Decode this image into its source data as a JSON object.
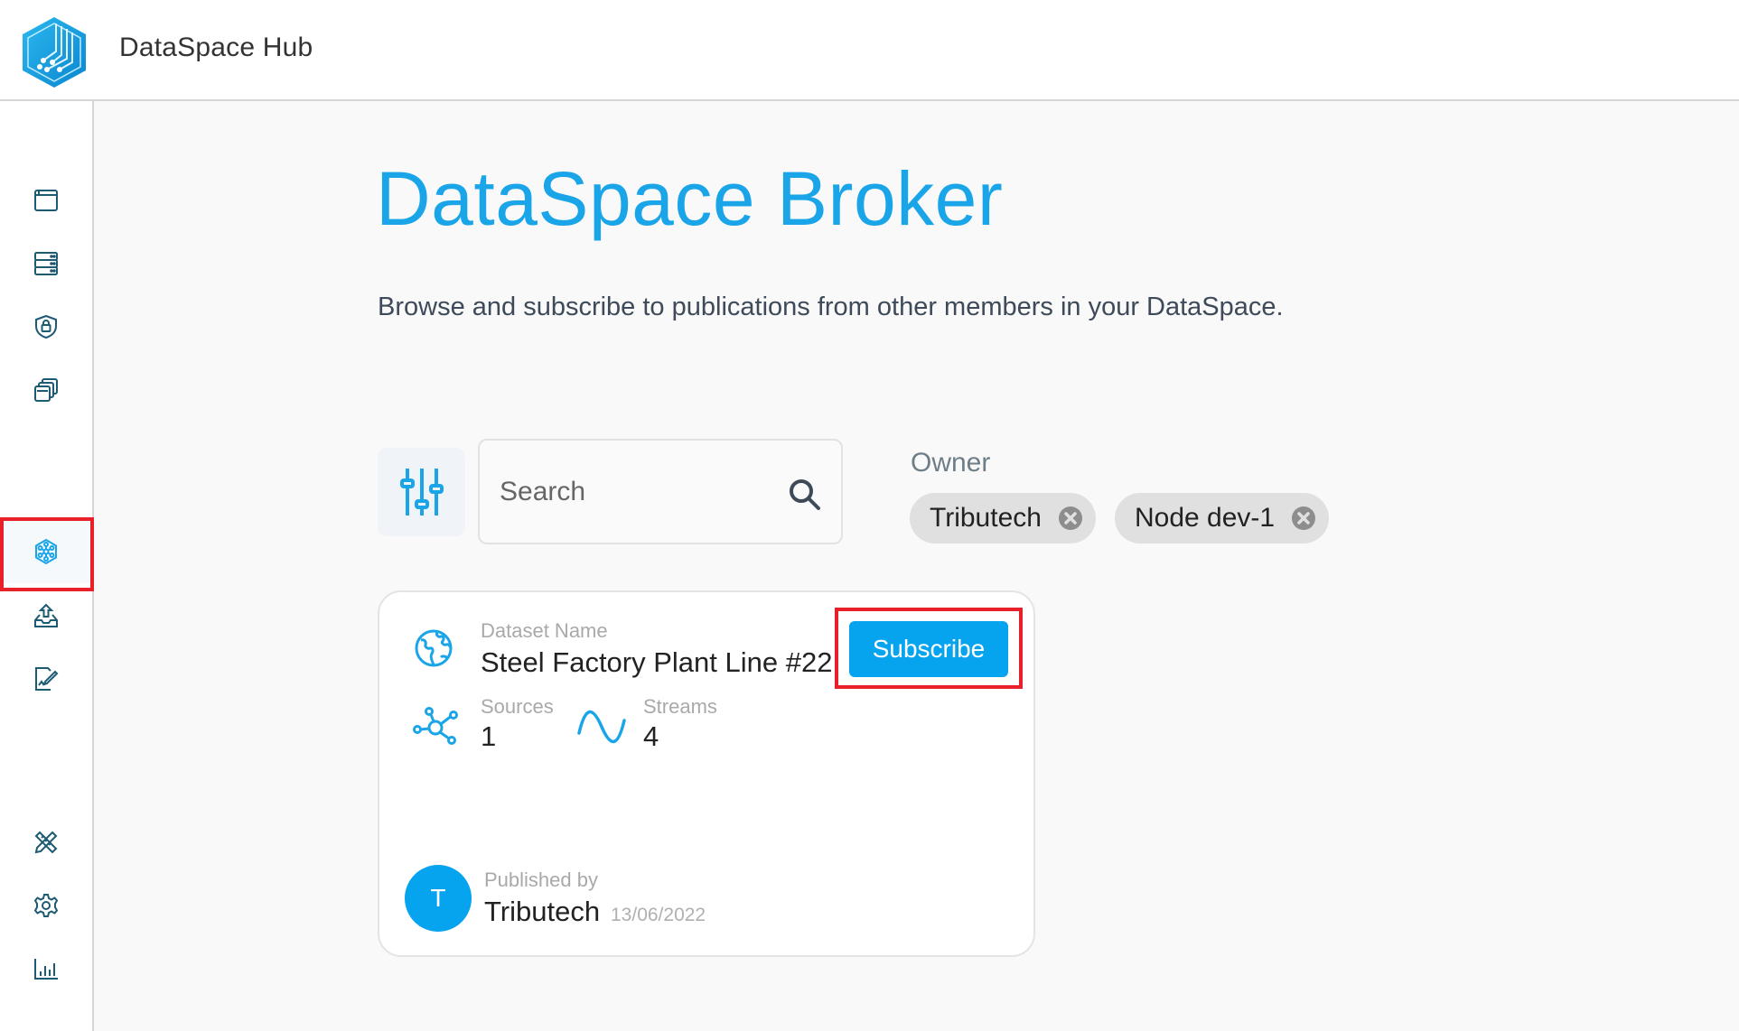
{
  "header": {
    "app_title": "DataSpace Hub",
    "logo_icon": "dataspace-hex-logo"
  },
  "sidebar": {
    "items": [
      {
        "icon": "browser-window-icon",
        "active": false
      },
      {
        "icon": "server-stack-icon",
        "active": false
      },
      {
        "icon": "shield-lock-icon",
        "active": false
      },
      {
        "icon": "stacked-windows-icon",
        "active": false
      },
      {
        "icon": "network-hexagon-icon",
        "active": true
      },
      {
        "icon": "upload-tray-icon",
        "active": false
      },
      {
        "icon": "signed-document-icon",
        "active": false
      },
      {
        "icon": "pencil-ruler-icon",
        "active": false
      },
      {
        "icon": "gear-icon",
        "active": false
      },
      {
        "icon": "bar-chart-icon",
        "active": false
      }
    ]
  },
  "main": {
    "title": "DataSpace Broker",
    "subtitle": "Browse and subscribe to publications from other members in your DataSpace.",
    "search": {
      "placeholder": "Search",
      "value": ""
    },
    "owner_filter": {
      "label": "Owner",
      "chips": [
        "Tributech",
        "Node dev-1"
      ]
    },
    "cards": [
      {
        "dataset_label": "Dataset Name",
        "dataset_name": "Steel Factory Plant Line #22",
        "subscribe_label": "Subscribe",
        "sources_label": "Sources",
        "sources_value": "1",
        "streams_label": "Streams",
        "streams_value": "4",
        "published_by_label": "Published by",
        "publisher": "Tributech",
        "publisher_initial": "T",
        "published_date": "13/06/2022"
      }
    ]
  },
  "colors": {
    "accent": "#1aa5e8",
    "button": "#06a3ef",
    "sidebar_icon": "#1d5a73",
    "highlight": "#e8202a"
  }
}
